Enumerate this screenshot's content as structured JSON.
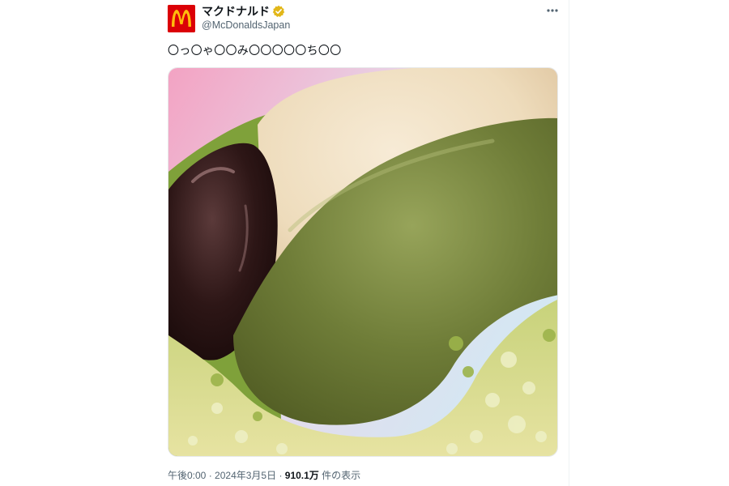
{
  "account": {
    "display_name": "マクドナルド",
    "handle": "@McDonaldsJapan",
    "verified": true,
    "brand_color": "#db0007",
    "logo_color": "#ffbc0d"
  },
  "post": {
    "text": "〇っ〇ゃ〇〇み〇〇〇〇〇ち〇〇",
    "media_alt_icon": "matcha-dessert-closeup-photo"
  },
  "meta": {
    "time": "午後0:00",
    "separator": "·",
    "date": "2024年3月5日",
    "views": "910.1万",
    "views_suffix": "件の表示"
  },
  "icons": {
    "more": "more-horizontal-icon",
    "verified": "verified-badge-icon",
    "avatar": "mcdonalds-logo-icon"
  }
}
